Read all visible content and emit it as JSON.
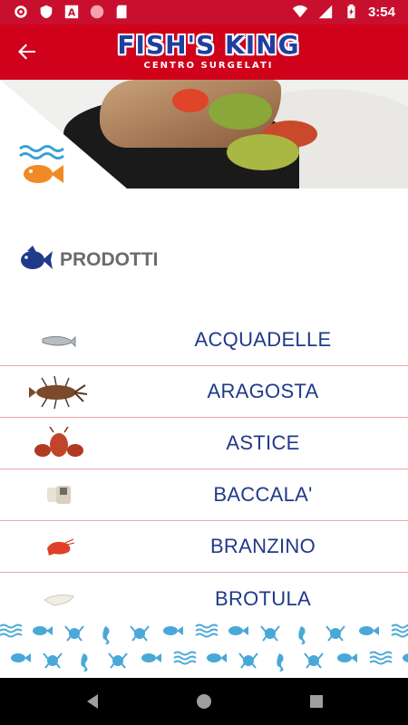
{
  "status_bar": {
    "time": "3:54",
    "left_icons": [
      "gear-icon",
      "shield-icon",
      "a-box-icon",
      "circle-icon",
      "sd-card-icon"
    ],
    "right_icons": [
      "wifi-icon",
      "signal-icon",
      "battery-charging-icon"
    ]
  },
  "app_bar": {
    "logo_title": "FISH'S KING",
    "logo_subtitle": "CENTRO SURGELATI",
    "background": "#d0021b",
    "logo_color": "#1f3fa0"
  },
  "section": {
    "title": "PRODOTTI"
  },
  "products": [
    {
      "name": "ACQUADELLE",
      "icon": "small-fish-icon"
    },
    {
      "name": "ARAGOSTA",
      "icon": "lobster-icon"
    },
    {
      "name": "ASTICE",
      "icon": "red-lobster-icon"
    },
    {
      "name": "BACCALA'",
      "icon": "cod-fillet-icon"
    },
    {
      "name": "BRANZINO",
      "icon": "shrimp-icon"
    },
    {
      "name": "BROTULA",
      "icon": "fillet-icon"
    }
  ],
  "colors": {
    "accent_red": "#c8102e",
    "product_text": "#1f3a8a",
    "divider": "#f0a8a8",
    "pattern": "#4aa8d8",
    "badge_fish": "#f08a24",
    "badge_waves": "#3aa0d8"
  },
  "pattern": {
    "row1": "≋ ➤ ✺ ♆ ✺ ≋ ➤ ♆ ✺ ≋ ➤ ✺ ♆ ≋ ➤ ✺",
    "row2": "➤ ✺ ≋ ♆ ➤ ✺ ≋ ♆ ➤ ✺ ≋ ♆ ➤ ✺ ≋"
  },
  "nav": {
    "buttons": [
      "back-triangle-icon",
      "home-circle-icon",
      "recents-square-icon"
    ]
  }
}
